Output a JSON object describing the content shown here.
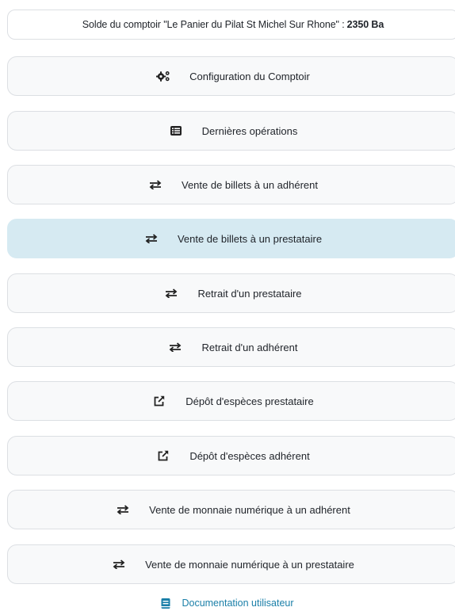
{
  "balance": {
    "label": "Solde du comptoir \"Le Panier du Pilat St Michel Sur Rhone\" :",
    "amount": "2350 Ba"
  },
  "menu": [
    {
      "label": "Configuration du Comptoir",
      "icon": "gears-icon"
    },
    {
      "label": "Dernières opérations",
      "icon": "list-icon"
    },
    {
      "label": "Vente de billets à un adhérent",
      "icon": "exchange-icon"
    },
    {
      "label": "Vente de billets à un prestataire",
      "icon": "exchange-icon",
      "active": true
    },
    {
      "label": "Retrait d'un prestataire",
      "icon": "exchange-icon"
    },
    {
      "label": "Retrait d'un adhérent",
      "icon": "exchange-icon"
    },
    {
      "label": "Dépôt d'espèces prestataire",
      "icon": "external-link-icon"
    },
    {
      "label": "Dépôt d'espèces adhérent",
      "icon": "external-link-icon"
    },
    {
      "label": "Vente de monnaie numérique à un adhérent",
      "icon": "exchange-icon"
    },
    {
      "label": "Vente de monnaie numérique à un prestataire",
      "icon": "exchange-icon"
    }
  ],
  "doc_link": {
    "label": "Documentation utilisateur",
    "icon": "book-icon",
    "color": "#1a7fa8"
  },
  "colors": {
    "active_bg": "#d6eaf2",
    "button_bg": "#f8f9fa",
    "border": "#dcdfe3"
  }
}
